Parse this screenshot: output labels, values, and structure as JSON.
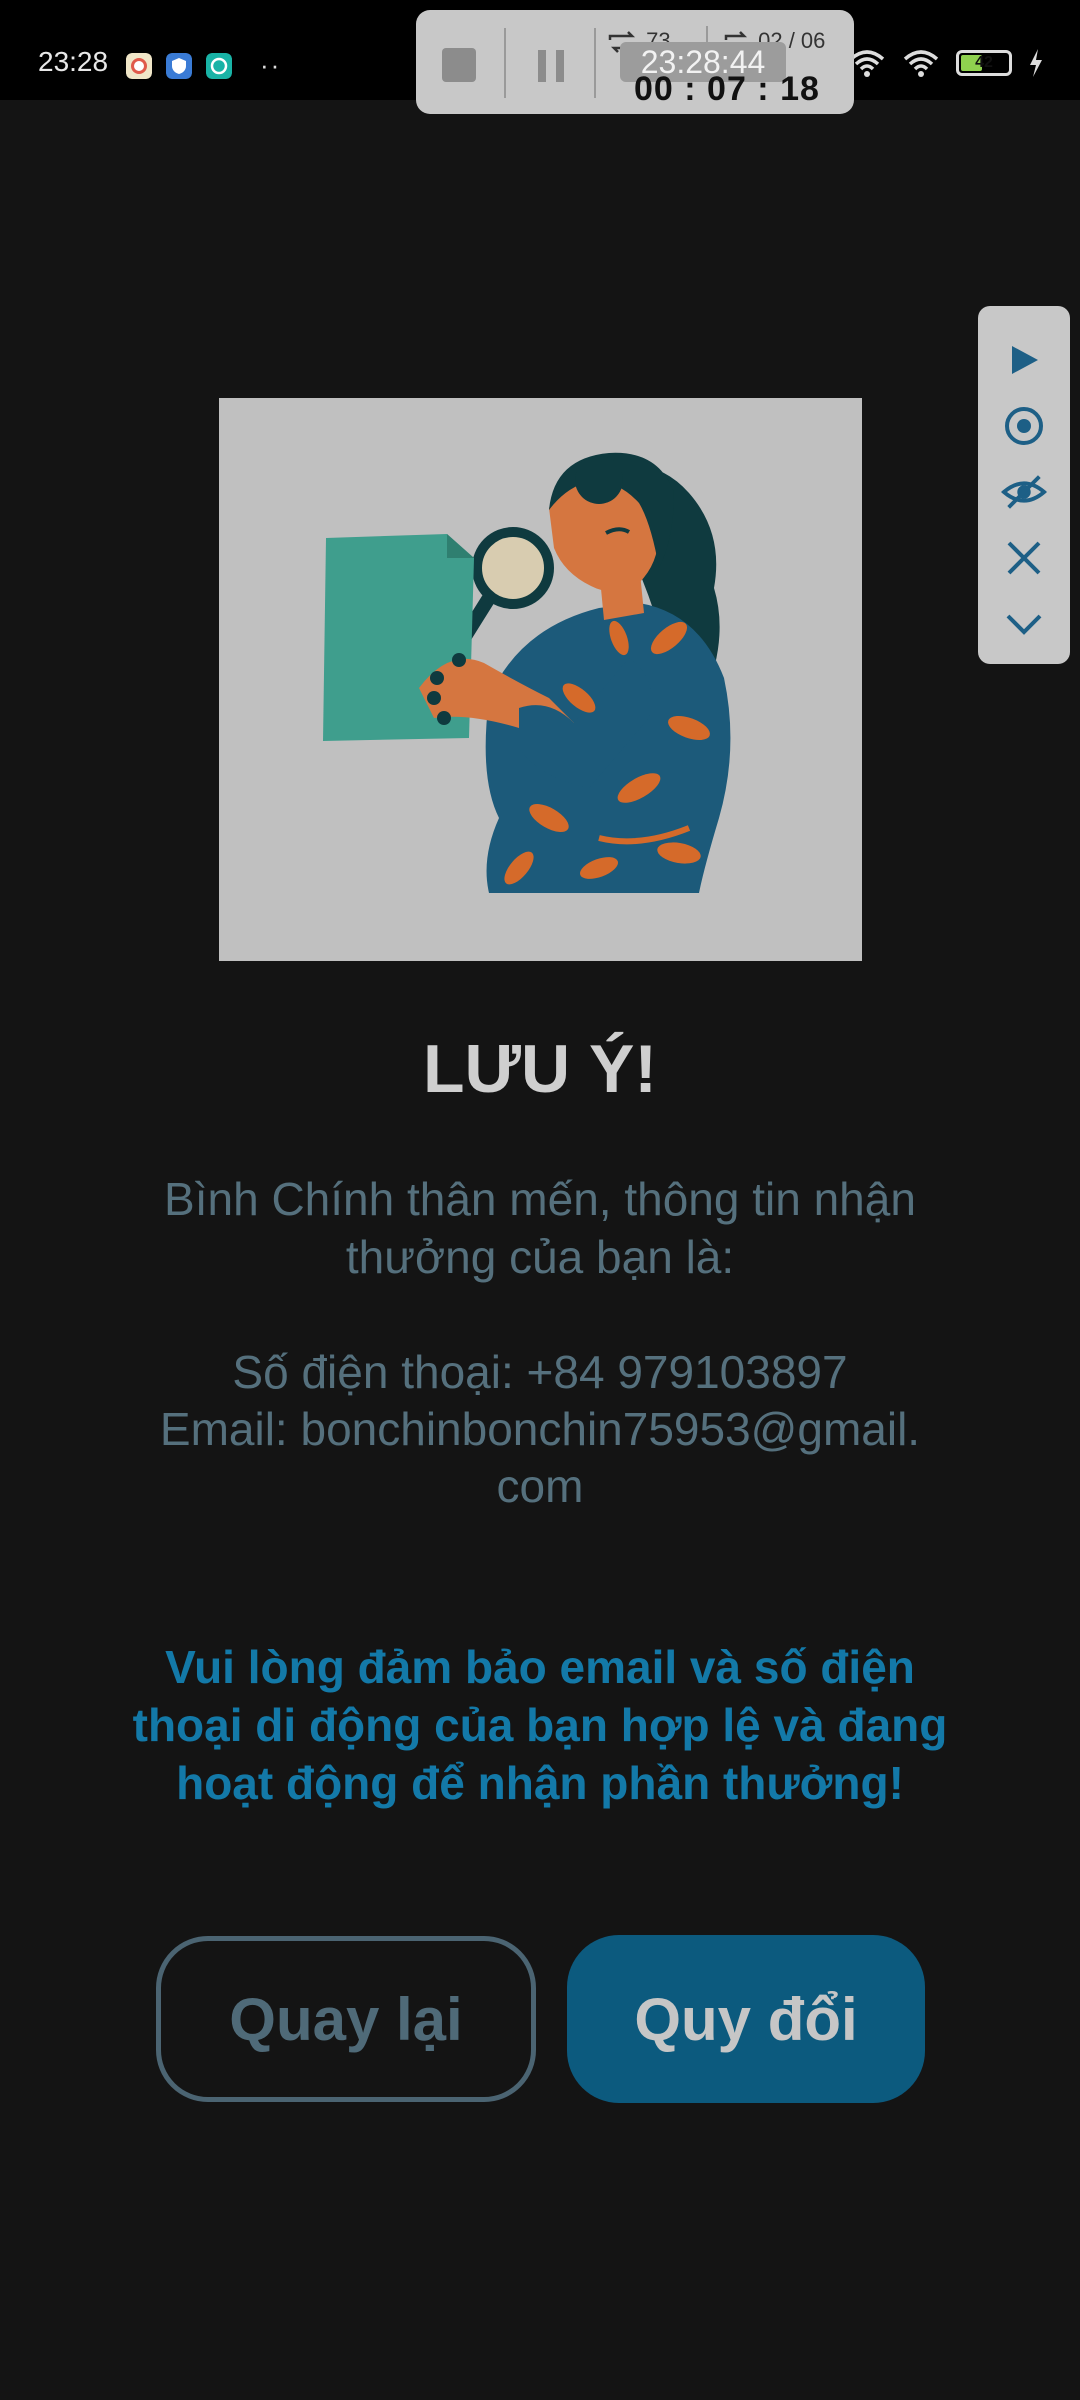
{
  "status_bar": {
    "time": "23:28",
    "battery_level": "42",
    "battery_fraction": 0.42,
    "icons": [
      "clock-app-icon",
      "shield-app-icon",
      "browser-app-icon",
      "overflow-dots-icon",
      "wifi-icon",
      "wifi-hotspot-icon",
      "battery-icon",
      "charging-icon"
    ],
    "dots": "··"
  },
  "recorder": {
    "loop_count": "73",
    "segment": "02 / 06",
    "clock": "23:28:44",
    "timer": "00 : 07 : 18",
    "icons": [
      "stop-icon",
      "pause-icon",
      "loop-icon",
      "segment-icon"
    ]
  },
  "side_panel": {
    "icons": [
      "play-icon",
      "record-icon",
      "eye-hidden-icon",
      "close-icon",
      "chevron-down-icon"
    ]
  },
  "dialog": {
    "title": "LƯU Ý!",
    "greeting": "Bình Chính thân mến, thông tin nhận thưởng của bạn là:",
    "phone_line": "Số điện thoại: +84 979103897",
    "email_line": "Email: bonchinbonchin75953@gmail.com",
    "warning": "Vui lòng đảm bảo email và số điện thoại di động của bạn hợp lệ và đang hoạt động để nhận phần thưởng!",
    "back_button": "Quay lại",
    "redeem_button": "Quy đổi"
  },
  "colors": {
    "background": "#141414",
    "accent_blue": "#1379a8",
    "button_fill": "#0c5a7e",
    "muted_text": "#55707d"
  }
}
